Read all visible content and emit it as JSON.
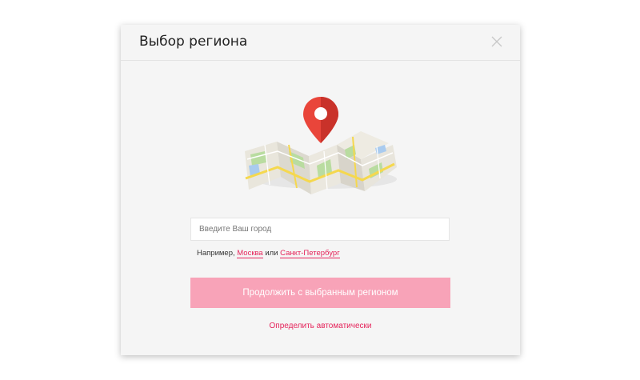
{
  "modal": {
    "title": "Выбор региона",
    "close_icon": "close-icon"
  },
  "illustration": {
    "icon": "map-with-location-pin-icon",
    "pin_color": "#e9453a"
  },
  "city_input": {
    "value": "",
    "placeholder": "Введите Ваш город"
  },
  "examples": {
    "prefix": "Например,",
    "city1": "Москва",
    "separator": "или",
    "city2": "Санкт-Петербург"
  },
  "continue_button": {
    "label": "Продолжить с выбранным регионом",
    "color": "#f8a3b8"
  },
  "auto_detect": {
    "label": "Определить автоматически",
    "color": "#e5235a"
  }
}
